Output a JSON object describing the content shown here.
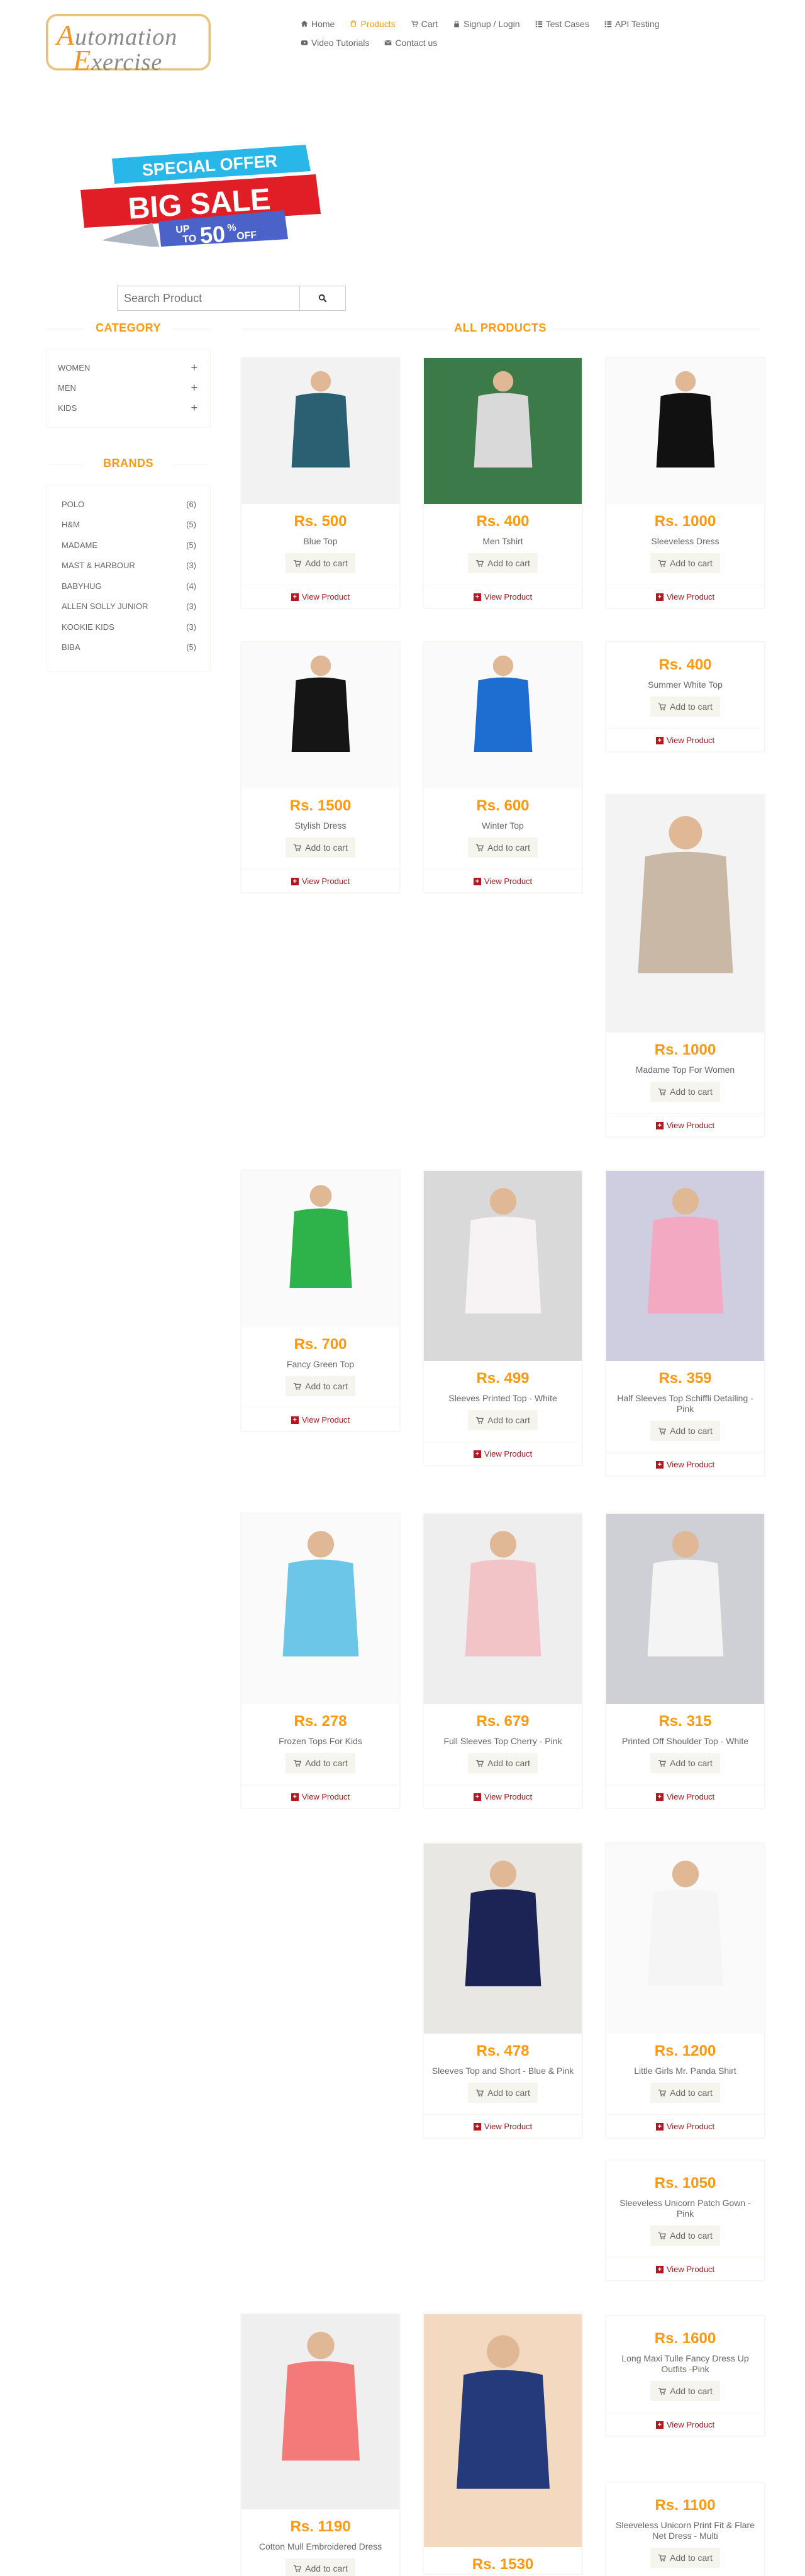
{
  "logo": {
    "line1_cap": "A",
    "line1_rest": "utomation",
    "line2_cap": "E",
    "line2_rest": "xercise"
  },
  "nav": [
    {
      "label": "Home",
      "icon": "home-icon",
      "active": false
    },
    {
      "label": "Products",
      "icon": "products-icon",
      "active": true
    },
    {
      "label": "Cart",
      "icon": "cart-icon",
      "active": false
    },
    {
      "label": "Signup / Login",
      "icon": "lock-icon",
      "active": false
    },
    {
      "label": "Test Cases",
      "icon": "list-icon",
      "active": false
    },
    {
      "label": "API Testing",
      "icon": "list-icon",
      "active": false
    },
    {
      "label": "Video Tutorials",
      "icon": "youtube-icon",
      "active": false
    },
    {
      "label": "Contact us",
      "icon": "envelope-icon",
      "active": false
    }
  ],
  "banner": {
    "line1": "SPECIAL OFFER",
    "line2": "BIG SALE",
    "line3a": "UP",
    "line3b": "TO",
    "line3c": "50",
    "line3d": "%",
    "line3e": "OFF"
  },
  "search": {
    "placeholder": "Search Product"
  },
  "sidebar": {
    "category_title": "CATEGORY",
    "categories": [
      "Women",
      "Men",
      "Kids"
    ],
    "brands_title": "BRANDS",
    "brands": [
      {
        "name": "Polo",
        "count": "(6)"
      },
      {
        "name": "H&M",
        "count": "(5)"
      },
      {
        "name": "Madame",
        "count": "(5)"
      },
      {
        "name": "Mast & Harbour",
        "count": "(3)"
      },
      {
        "name": "Babyhug",
        "count": "(4)"
      },
      {
        "name": "Allen Solly Junior",
        "count": "(3)"
      },
      {
        "name": "Kookie Kids",
        "count": "(3)"
      },
      {
        "name": "Biba",
        "count": "(5)"
      }
    ]
  },
  "main": {
    "title": "ALL PRODUCTS",
    "add_to_cart": "Add to cart",
    "view_product": "View Product",
    "products": [
      {
        "price": "Rs. 500",
        "name": "Blue Top"
      },
      {
        "price": "Rs. 400",
        "name": "Men Tshirt"
      },
      {
        "price": "Rs. 1000",
        "name": "Sleeveless Dress"
      },
      {
        "price": "Rs. 1500",
        "name": "Stylish Dress"
      },
      {
        "price": "Rs. 600",
        "name": "Winter Top"
      },
      {
        "price": "Rs. 400",
        "name": "Summer White Top"
      },
      {
        "price": "Rs. 1000",
        "name": "Madame Top For Women"
      },
      {
        "price": "Rs. 700",
        "name": "Fancy Green Top"
      },
      {
        "price": "Rs. 499",
        "name": "Sleeves Printed Top - White"
      },
      {
        "price": "Rs. 359",
        "name": "Half Sleeves Top Schiffli Detailing - Pink"
      },
      {
        "price": "Rs. 278",
        "name": "Frozen Tops For Kids"
      },
      {
        "price": "Rs. 679",
        "name": "Full Sleeves Top Cherry - Pink"
      },
      {
        "price": "Rs. 315",
        "name": "Printed Off Shoulder Top - White"
      },
      {
        "price": "Rs. 478",
        "name": "Sleeves Top and Short - Blue & Pink"
      },
      {
        "price": "Rs. 1200",
        "name": "Little Girls Mr. Panda Shirt"
      },
      {
        "price": "Rs. 1050",
        "name": "Sleeveless Unicorn Patch Gown - Pink"
      },
      {
        "price": "Rs. 1600",
        "name": "Long Maxi Tulle Fancy Dress Up Outfits -Pink"
      },
      {
        "price": "Rs. 1100",
        "name": "Sleeveless Unicorn Print Fit & Flare Net Dress - Multi"
      },
      {
        "price": "Rs. 1190",
        "name": "Cotton Mull Embroidered Dress"
      },
      {
        "price": "Rs. 1530",
        "name": ""
      }
    ]
  }
}
